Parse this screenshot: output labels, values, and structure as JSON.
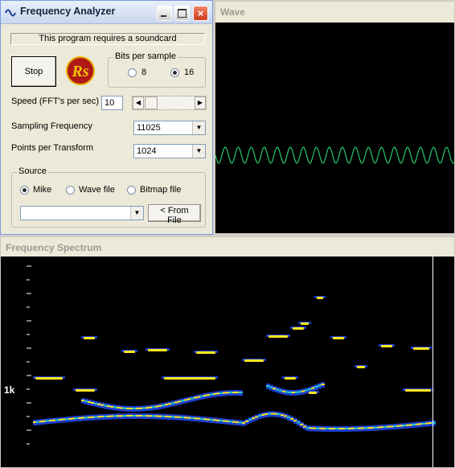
{
  "control": {
    "title": "Frequency Analyzer",
    "close_glyph": "×",
    "notice": "This program requires a soundcard",
    "stop_label": "Stop",
    "logo_icon": "rs-logo-icon",
    "bits": {
      "label": "Bits per sample",
      "options": [
        "8",
        "16"
      ],
      "selected": "16"
    },
    "speed": {
      "label": "Speed (FFT's per sec)",
      "value": "10"
    },
    "sampling": {
      "label": "Sampling Frequency",
      "value": "11025"
    },
    "points": {
      "label": "Points per Transform",
      "value": "1024"
    },
    "source": {
      "label": "Source",
      "options": [
        "Mike",
        "Wave file",
        "Bitmap file"
      ],
      "selected": "Mike",
      "file_value": "",
      "from_file_label": "< From File"
    }
  },
  "wave": {
    "title": "Wave",
    "trace_color": "#26c86a"
  },
  "spectrum": {
    "title": "Frequency Spectrum",
    "axis_label": "1k"
  },
  "colors": {
    "accent": "#7a96df",
    "close": "#d9532f",
    "panel": "#ece9d8"
  }
}
